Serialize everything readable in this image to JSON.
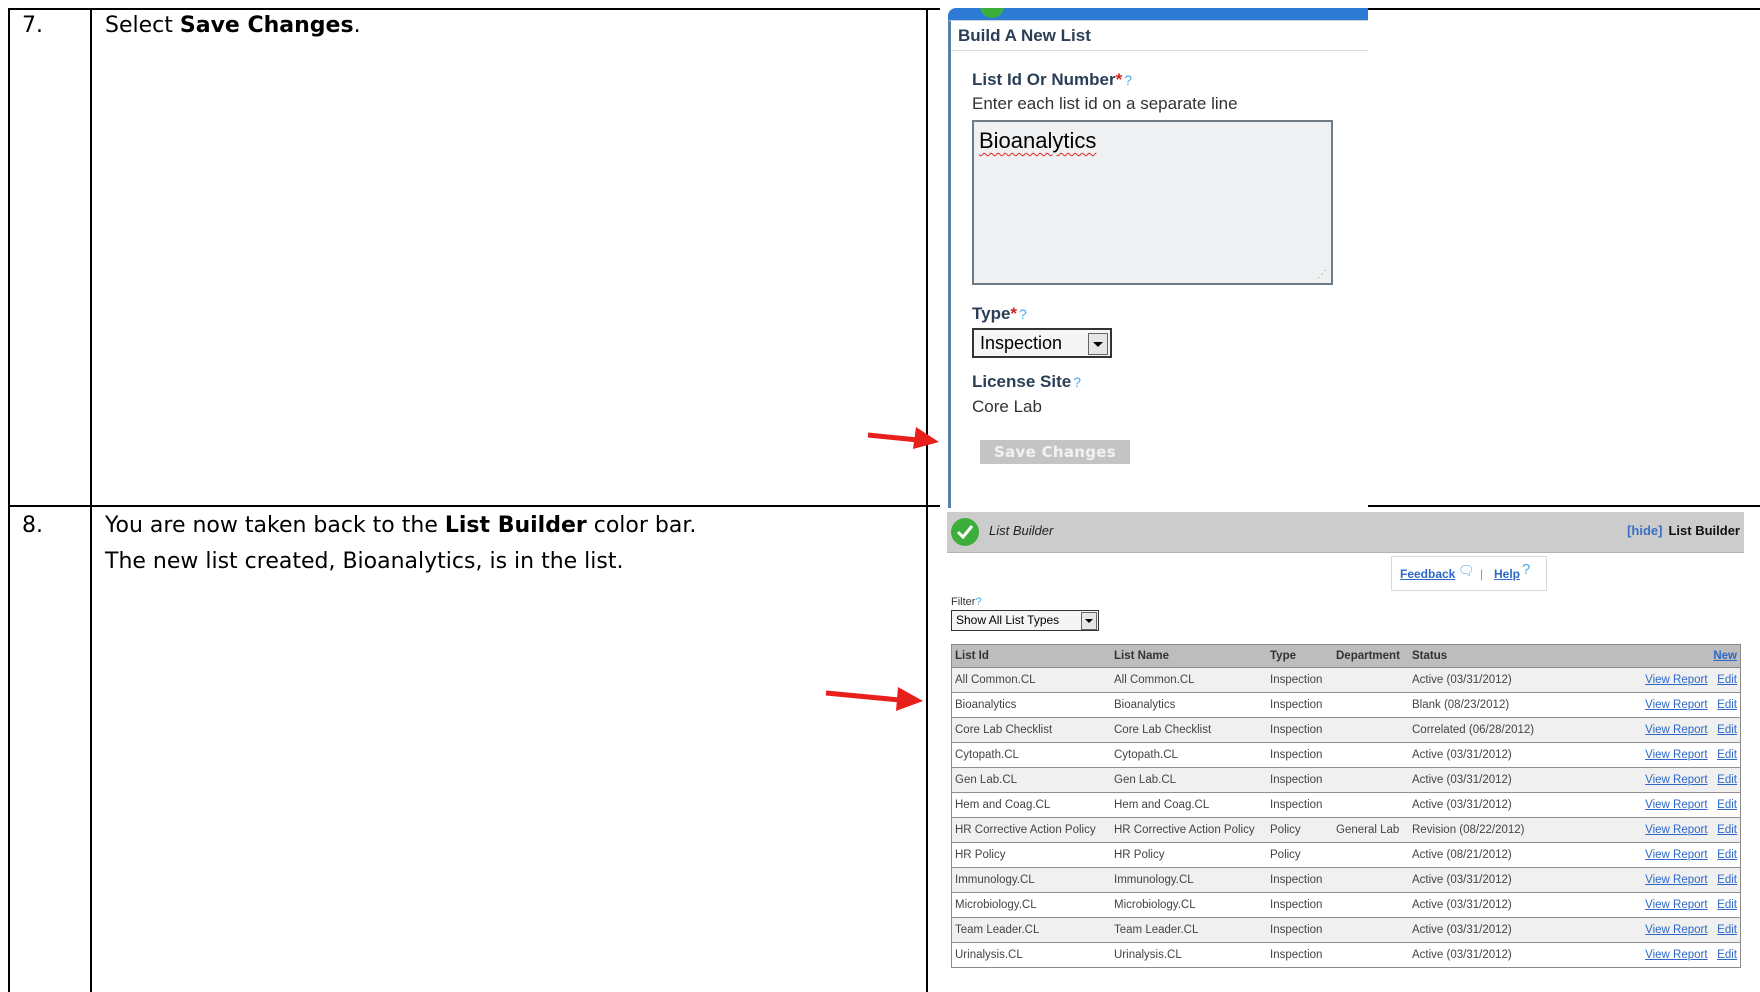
{
  "steps": [
    {
      "number": "7.",
      "text_before": "Select ",
      "text_bold": "Save Changes",
      "text_after": "."
    },
    {
      "number": "8.",
      "line1_before": "You are now taken back to the ",
      "line1_bold": "List Builder",
      "line1_after": " color bar.",
      "line2": "The new list created, Bioanalytics, is in the list."
    }
  ],
  "build_form": {
    "title": "Build A New List",
    "list_id_label": "List Id Or Number",
    "required_mark": "*",
    "help_mark": "?",
    "list_id_hint": "Enter each list id on a separate line",
    "list_id_value": "Bioanalytics",
    "type_label": "Type",
    "type_value": "Inspection",
    "license_label": "License Site",
    "license_value": "Core Lab",
    "save_button": "Save Changes"
  },
  "list_builder": {
    "bar_title": "List Builder",
    "hide_link": "[hide]",
    "bar_right_title": "List Builder",
    "feedback_link": "Feedback",
    "help_link": "Help",
    "help_mark": "?",
    "filter_label": "Filter",
    "filter_value": "Show All List Types",
    "columns": [
      "List Id",
      "List Name",
      "Type",
      "Department",
      "Status"
    ],
    "new_link": "New",
    "view_report_label": "View Report",
    "edit_label": "Edit",
    "rows": [
      [
        "All Common.CL",
        "All Common.CL",
        "Inspection",
        "",
        "Active (03/31/2012)"
      ],
      [
        "Bioanalytics",
        "Bioanalytics",
        "Inspection",
        "",
        "Blank (08/23/2012)"
      ],
      [
        "Core Lab Checklist",
        "Core Lab Checklist",
        "Inspection",
        "",
        "Correlated (06/28/2012)"
      ],
      [
        "Cytopath.CL",
        "Cytopath.CL",
        "Inspection",
        "",
        "Active (03/31/2012)"
      ],
      [
        "Gen Lab.CL",
        "Gen Lab.CL",
        "Inspection",
        "",
        "Active (03/31/2012)"
      ],
      [
        "Hem and Coag.CL",
        "Hem and Coag.CL",
        "Inspection",
        "",
        "Active (03/31/2012)"
      ],
      [
        "HR Corrective Action Policy",
        "HR Corrective Action Policy",
        "Policy",
        "General Lab",
        "Revision (08/22/2012)"
      ],
      [
        "HR Policy",
        "HR Policy",
        "Policy",
        "",
        "Active (08/21/2012)"
      ],
      [
        "Immunology.CL",
        "Immunology.CL",
        "Inspection",
        "",
        "Active (03/31/2012)"
      ],
      [
        "Microbiology.CL",
        "Microbiology.CL",
        "Inspection",
        "",
        "Active (03/31/2012)"
      ],
      [
        "Team Leader.CL",
        "Team Leader.CL",
        "Inspection",
        "",
        "Active (03/31/2012)"
      ],
      [
        "Urinalysis.CL",
        "Urinalysis.CL",
        "Inspection",
        "",
        "Active (03/31/2012)"
      ]
    ]
  },
  "colors": {
    "arrow": "#e8201c",
    "link": "#2d68c6",
    "check": "#3cae3c"
  }
}
